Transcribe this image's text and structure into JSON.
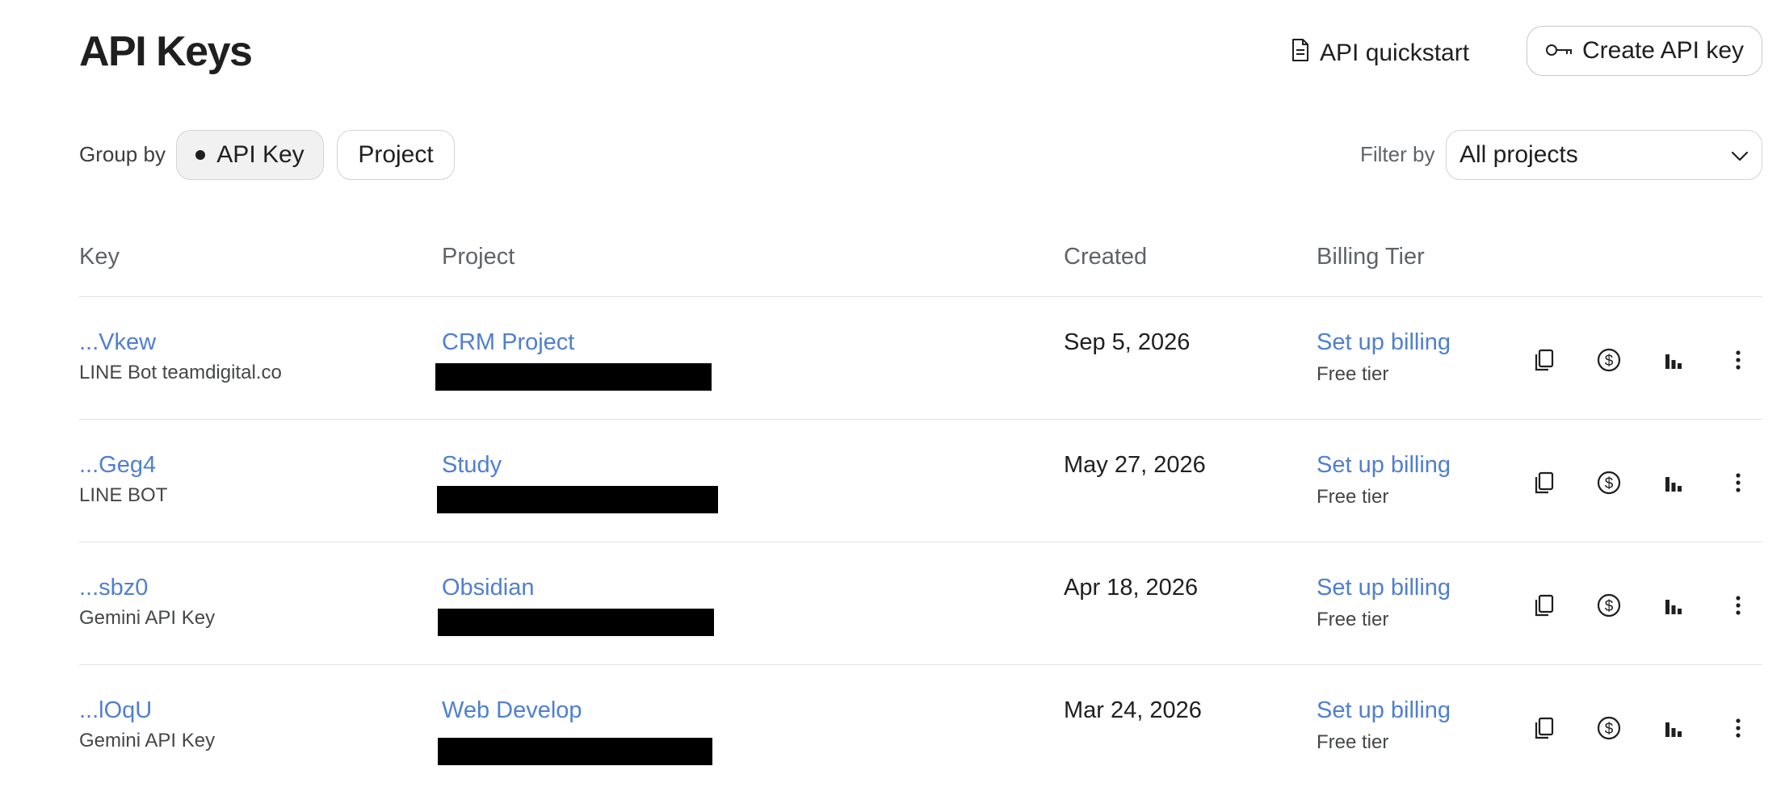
{
  "header": {
    "title": "API Keys",
    "quickstart_label": "API quickstart",
    "create_label": "Create API key"
  },
  "toolbar": {
    "group_by_label": "Group by",
    "group_options": [
      {
        "label": "API Key",
        "selected": true
      },
      {
        "label": "Project",
        "selected": false
      }
    ],
    "filter_label": "Filter by",
    "filter_value": "All projects"
  },
  "table": {
    "columns": [
      "Key",
      "Project",
      "Created",
      "Billing Tier"
    ],
    "rows": [
      {
        "key": "...Vkew",
        "key_name": "LINE Bot teamdigital.co",
        "project": "CRM Project",
        "created": "Sep 5, 2026",
        "billing_action": "Set up billing",
        "tier": "Free tier"
      },
      {
        "key": "...Geg4",
        "key_name": "LINE BOT",
        "project": "Study",
        "created": "May 27, 2026",
        "billing_action": "Set up billing",
        "tier": "Free tier"
      },
      {
        "key": "...sbz0",
        "key_name": "Gemini API Key",
        "project": "Obsidian",
        "created": "Apr 18, 2026",
        "billing_action": "Set up billing",
        "tier": "Free tier"
      },
      {
        "key": "...lOqU",
        "key_name": "Gemini API Key",
        "project": "Web Develop",
        "created": "Mar 24, 2026",
        "billing_action": "Set up billing",
        "tier": "Free tier"
      }
    ]
  },
  "icons": {
    "quickstart": "document-icon",
    "create": "key-icon",
    "filter": "chevron-down-icon",
    "row_actions": [
      "copy-icon",
      "dollar-icon",
      "bar-chart-icon",
      "more-vert-icon"
    ]
  },
  "colors": {
    "link": "#4f7fd0",
    "text": "#1f1f1f",
    "muted": "#5f6368",
    "border": "#d3d3d3",
    "redaction": "#000000"
  }
}
